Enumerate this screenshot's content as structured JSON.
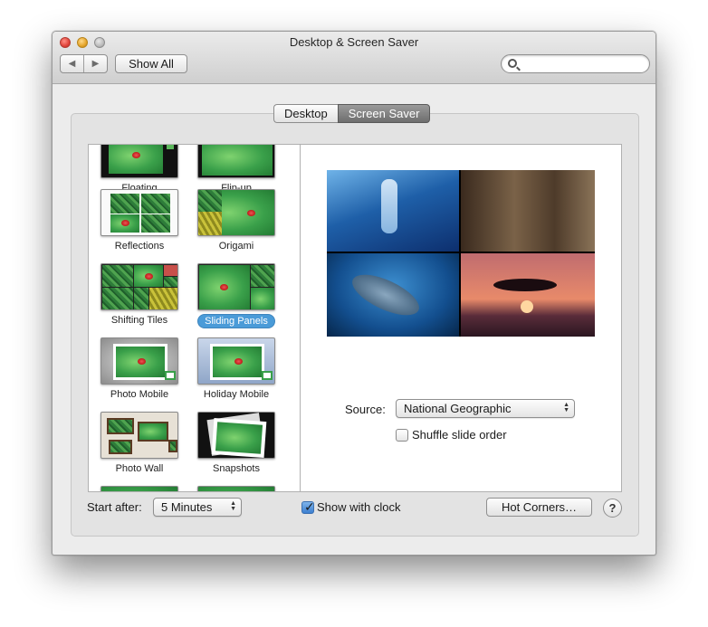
{
  "window": {
    "title": "Desktop & Screen Saver",
    "nav_back": "◀",
    "nav_forward": "▶",
    "show_all": "Show All",
    "search_placeholder": ""
  },
  "tabs": [
    {
      "label": "Desktop",
      "selected": false
    },
    {
      "label": "Screen Saver",
      "selected": true
    }
  ],
  "savers": [
    {
      "label": "Floating"
    },
    {
      "label": "Flip-up"
    },
    {
      "label": "Reflections"
    },
    {
      "label": "Origami"
    },
    {
      "label": "Shifting Tiles"
    },
    {
      "label": "Sliding Panels",
      "selected": true
    },
    {
      "label": "Photo Mobile"
    },
    {
      "label": "Holiday Mobile"
    },
    {
      "label": "Photo Wall"
    },
    {
      "label": "Snapshots"
    }
  ],
  "options": {
    "source_label": "Source:",
    "source_value": "National Geographic",
    "shuffle_label": "Shuffle slide order",
    "shuffle_checked": false
  },
  "footer": {
    "start_after_label": "Start after:",
    "start_after_value": "5 Minutes",
    "show_clock_label": "Show with clock",
    "show_clock_checked": true,
    "hot_corners_label": "Hot Corners…",
    "help_label": "?"
  },
  "colors": {
    "selection": "#4a9bd8",
    "selected_tab": "#7a7a7a"
  }
}
